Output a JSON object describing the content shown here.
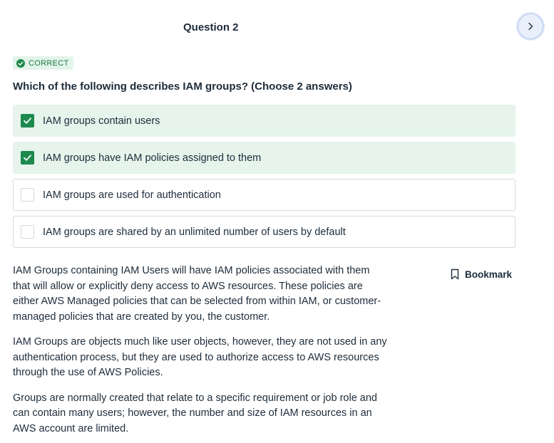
{
  "header": {
    "question_title": "Question 2",
    "next_icon": "chevron-right-icon"
  },
  "status": {
    "label": "CORRECT",
    "icon": "check-circle-icon",
    "color": "#1d8a4d"
  },
  "question": {
    "prompt": "Which of the following describes IAM groups? (Choose 2 answers)",
    "options": [
      {
        "label": "IAM groups contain users",
        "checked": true,
        "correct": true
      },
      {
        "label": "IAM groups have IAM policies assigned to them",
        "checked": true,
        "correct": true
      },
      {
        "label": "IAM groups are used for authentication",
        "checked": false,
        "correct": false
      },
      {
        "label": "IAM groups are shared by an unlimited number of users by default",
        "checked": false,
        "correct": false
      }
    ]
  },
  "explanation": {
    "paragraphs": [
      "IAM Groups containing IAM Users will have IAM policies associated with them that will allow or explicitly deny access to AWS resources. These policies are either AWS Managed policies that can be selected from within IAM, or customer-managed policies that are created by you, the customer.",
      "IAM Groups are objects much like user objects, however, they are not used in any authentication process, but they are used to authorize access to AWS resources through the use of AWS Policies.",
      "Groups are normally created that relate to a specific requirement or job role and can contain many users; however, the number and size of IAM resources in an AWS account are limited."
    ]
  },
  "bookmark": {
    "label": "Bookmark",
    "icon": "bookmark-icon"
  },
  "colors": {
    "accent_green": "#1d8a4d",
    "correct_bg": "#e6f4ec",
    "border": "#d5d9dd"
  }
}
